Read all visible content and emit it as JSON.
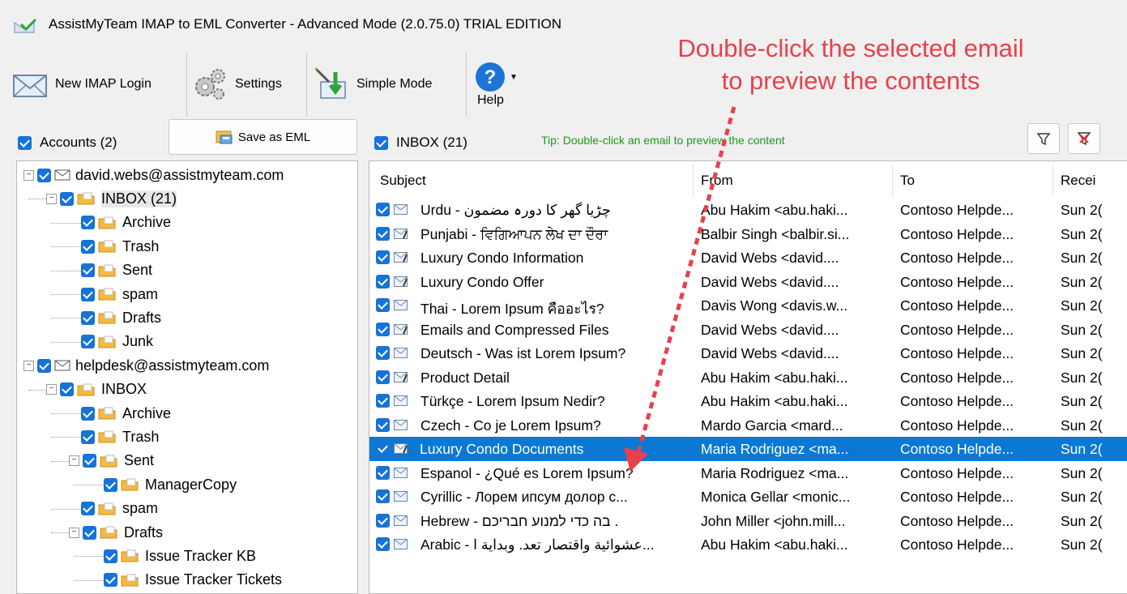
{
  "window": {
    "title": "AssistMyTeam IMAP to EML Converter - Advanced Mode (2.0.75.0) TRIAL EDITION"
  },
  "toolbar": {
    "new_login": "New IMAP Login",
    "settings": "Settings",
    "simple_mode": "Simple Mode",
    "help": "Help"
  },
  "annotation": {
    "line1": "Double-click the selected email",
    "line2": "to preview the contents"
  },
  "accounts": {
    "label": "Accounts (2)",
    "save_button": "Save as EML"
  },
  "tree": [
    {
      "label": "david.webs@assistmyteam.com",
      "level": 0,
      "type": "account",
      "expander": "−"
    },
    {
      "label": "INBOX (21)",
      "level": 1,
      "type": "folder",
      "expander": "−",
      "selected": true
    },
    {
      "label": "Archive",
      "level": 2,
      "type": "folder"
    },
    {
      "label": "Trash",
      "level": 2,
      "type": "folder"
    },
    {
      "label": "Sent",
      "level": 2,
      "type": "folder"
    },
    {
      "label": "spam",
      "level": 2,
      "type": "folder"
    },
    {
      "label": "Drafts",
      "level": 2,
      "type": "folder"
    },
    {
      "label": "Junk",
      "level": 2,
      "type": "folder"
    },
    {
      "label": "helpdesk@assistmyteam.com",
      "level": 0,
      "type": "account",
      "expander": "−"
    },
    {
      "label": "INBOX",
      "level": 1,
      "type": "folder",
      "expander": "−"
    },
    {
      "label": "Archive",
      "level": 2,
      "type": "folder"
    },
    {
      "label": "Trash",
      "level": 2,
      "type": "folder"
    },
    {
      "label": "Sent",
      "level": 2,
      "type": "folder",
      "expander": "−"
    },
    {
      "label": "ManagerCopy",
      "level": 3,
      "type": "folder"
    },
    {
      "label": "spam",
      "level": 2,
      "type": "folder"
    },
    {
      "label": "Drafts",
      "level": 2,
      "type": "folder",
      "expander": "−"
    },
    {
      "label": "Issue Tracker KB",
      "level": 3,
      "type": "folder"
    },
    {
      "label": "Issue Tracker Tickets",
      "level": 3,
      "type": "folder"
    }
  ],
  "inbox": {
    "label": "INBOX (21)",
    "tip": "Tip: Double-click an email to preview the content"
  },
  "columns": {
    "subject": "Subject",
    "from": "From",
    "to": "To",
    "received": "Recei"
  },
  "emails": [
    {
      "subject": "Urdu - چڑیا گھر کا دورہ مضمون",
      "from": "Abu Hakim <abu.haki...",
      "to": "Contoso Helpde...",
      "received": "Sun 2(",
      "attach": false
    },
    {
      "subject": "Punjabi - ਵਿਗਿਆਪਨ ਲੇਖ ਦਾ ਦੌਰਾ",
      "from": "Balbir Singh <balbir.si...",
      "to": "Contoso Helpde...",
      "received": "Sun 2(",
      "attach": true
    },
    {
      "subject": "Luxury Condo Information",
      "from": "David Webs <david....",
      "to": "Contoso Helpde...",
      "received": "Sun 2(",
      "attach": true
    },
    {
      "subject": "Luxury Condo Offer",
      "from": "David Webs <david....",
      "to": "Contoso Helpde...",
      "received": "Sun 2(",
      "attach": true
    },
    {
      "subject": "Thai - Lorem Ipsum คืออะไร?",
      "from": "Davis Wong <davis.w...",
      "to": "Contoso Helpde...",
      "received": "Sun 2(",
      "attach": false
    },
    {
      "subject": "Emails and Compressed Files",
      "from": "David Webs <david....",
      "to": "Contoso Helpde...",
      "received": "Sun 2(",
      "attach": true
    },
    {
      "subject": "Deutsch - Was ist Lorem Ipsum?",
      "from": "David Webs <david....",
      "to": "Contoso Helpde...",
      "received": "Sun 2(",
      "attach": false
    },
    {
      "subject": "Product Detail",
      "from": "Abu Hakim <abu.haki...",
      "to": "Contoso Helpde...",
      "received": "Sun 2(",
      "attach": true
    },
    {
      "subject": "Türkçe - Lorem Ipsum Nedir?",
      "from": "Abu Hakim <abu.haki...",
      "to": "Contoso Helpde...",
      "received": "Sun 2(",
      "attach": false
    },
    {
      "subject": "Czech - Co je Lorem Ipsum?",
      "from": "Mardo Garcia <mard...",
      "to": "Contoso Helpde...",
      "received": "Sun 2(",
      "attach": false
    },
    {
      "subject": "Luxury Condo Documents",
      "from": "Maria Rodriguez <ma...",
      "to": "Contoso Helpde...",
      "received": "Sun 2(",
      "attach": true,
      "selected": true
    },
    {
      "subject": "Espanol - ¿Qué es Lorem Ipsum?",
      "from": "Maria Rodriguez <ma...",
      "to": "Contoso Helpde...",
      "received": "Sun 2(",
      "attach": false
    },
    {
      "subject": "Cyrillic - Лорем ипсум долор с...",
      "from": "Monica Gellar <monic...",
      "to": "Contoso Helpde...",
      "received": "Sun 2(",
      "attach": false
    },
    {
      "subject": "Hebrew - בה כדי למנוע חבריכם .",
      "from": "John Miller <john.mill...",
      "to": "Contoso Helpde...",
      "received": "Sun 2(",
      "attach": false
    },
    {
      "subject": "Arabic - عشوائية واقتصار تعد. وبداية ا...",
      "from": "Abu Hakim <abu.haki...",
      "to": "Contoso Helpde...",
      "received": "Sun 2(",
      "attach": false
    }
  ],
  "colors": {
    "accent": "#0b78d4",
    "annotation": "#e8414b",
    "tip": "#1a9a1a",
    "folder": "#f5b942"
  }
}
